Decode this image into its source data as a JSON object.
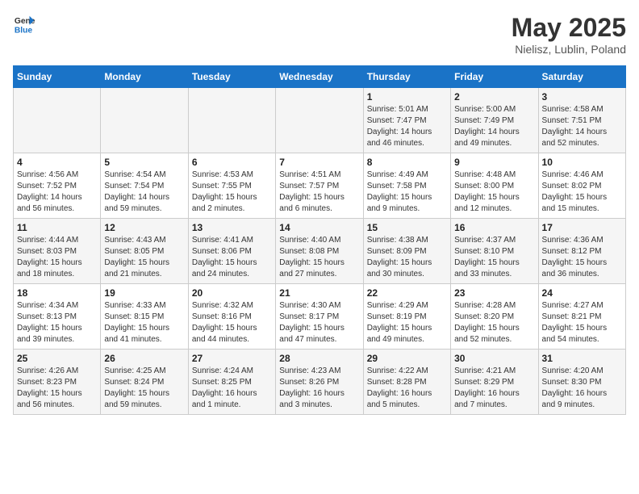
{
  "logo": {
    "line1": "General",
    "line2": "Blue"
  },
  "title": "May 2025",
  "subtitle": "Nielisz, Lublin, Poland",
  "weekdays": [
    "Sunday",
    "Monday",
    "Tuesday",
    "Wednesday",
    "Thursday",
    "Friday",
    "Saturday"
  ],
  "weeks": [
    [
      {
        "day": "",
        "info": ""
      },
      {
        "day": "",
        "info": ""
      },
      {
        "day": "",
        "info": ""
      },
      {
        "day": "",
        "info": ""
      },
      {
        "day": "1",
        "info": "Sunrise: 5:01 AM\nSunset: 7:47 PM\nDaylight: 14 hours\nand 46 minutes."
      },
      {
        "day": "2",
        "info": "Sunrise: 5:00 AM\nSunset: 7:49 PM\nDaylight: 14 hours\nand 49 minutes."
      },
      {
        "day": "3",
        "info": "Sunrise: 4:58 AM\nSunset: 7:51 PM\nDaylight: 14 hours\nand 52 minutes."
      }
    ],
    [
      {
        "day": "4",
        "info": "Sunrise: 4:56 AM\nSunset: 7:52 PM\nDaylight: 14 hours\nand 56 minutes."
      },
      {
        "day": "5",
        "info": "Sunrise: 4:54 AM\nSunset: 7:54 PM\nDaylight: 14 hours\nand 59 minutes."
      },
      {
        "day": "6",
        "info": "Sunrise: 4:53 AM\nSunset: 7:55 PM\nDaylight: 15 hours\nand 2 minutes."
      },
      {
        "day": "7",
        "info": "Sunrise: 4:51 AM\nSunset: 7:57 PM\nDaylight: 15 hours\nand 6 minutes."
      },
      {
        "day": "8",
        "info": "Sunrise: 4:49 AM\nSunset: 7:58 PM\nDaylight: 15 hours\nand 9 minutes."
      },
      {
        "day": "9",
        "info": "Sunrise: 4:48 AM\nSunset: 8:00 PM\nDaylight: 15 hours\nand 12 minutes."
      },
      {
        "day": "10",
        "info": "Sunrise: 4:46 AM\nSunset: 8:02 PM\nDaylight: 15 hours\nand 15 minutes."
      }
    ],
    [
      {
        "day": "11",
        "info": "Sunrise: 4:44 AM\nSunset: 8:03 PM\nDaylight: 15 hours\nand 18 minutes."
      },
      {
        "day": "12",
        "info": "Sunrise: 4:43 AM\nSunset: 8:05 PM\nDaylight: 15 hours\nand 21 minutes."
      },
      {
        "day": "13",
        "info": "Sunrise: 4:41 AM\nSunset: 8:06 PM\nDaylight: 15 hours\nand 24 minutes."
      },
      {
        "day": "14",
        "info": "Sunrise: 4:40 AM\nSunset: 8:08 PM\nDaylight: 15 hours\nand 27 minutes."
      },
      {
        "day": "15",
        "info": "Sunrise: 4:38 AM\nSunset: 8:09 PM\nDaylight: 15 hours\nand 30 minutes."
      },
      {
        "day": "16",
        "info": "Sunrise: 4:37 AM\nSunset: 8:10 PM\nDaylight: 15 hours\nand 33 minutes."
      },
      {
        "day": "17",
        "info": "Sunrise: 4:36 AM\nSunset: 8:12 PM\nDaylight: 15 hours\nand 36 minutes."
      }
    ],
    [
      {
        "day": "18",
        "info": "Sunrise: 4:34 AM\nSunset: 8:13 PM\nDaylight: 15 hours\nand 39 minutes."
      },
      {
        "day": "19",
        "info": "Sunrise: 4:33 AM\nSunset: 8:15 PM\nDaylight: 15 hours\nand 41 minutes."
      },
      {
        "day": "20",
        "info": "Sunrise: 4:32 AM\nSunset: 8:16 PM\nDaylight: 15 hours\nand 44 minutes."
      },
      {
        "day": "21",
        "info": "Sunrise: 4:30 AM\nSunset: 8:17 PM\nDaylight: 15 hours\nand 47 minutes."
      },
      {
        "day": "22",
        "info": "Sunrise: 4:29 AM\nSunset: 8:19 PM\nDaylight: 15 hours\nand 49 minutes."
      },
      {
        "day": "23",
        "info": "Sunrise: 4:28 AM\nSunset: 8:20 PM\nDaylight: 15 hours\nand 52 minutes."
      },
      {
        "day": "24",
        "info": "Sunrise: 4:27 AM\nSunset: 8:21 PM\nDaylight: 15 hours\nand 54 minutes."
      }
    ],
    [
      {
        "day": "25",
        "info": "Sunrise: 4:26 AM\nSunset: 8:23 PM\nDaylight: 15 hours\nand 56 minutes."
      },
      {
        "day": "26",
        "info": "Sunrise: 4:25 AM\nSunset: 8:24 PM\nDaylight: 15 hours\nand 59 minutes."
      },
      {
        "day": "27",
        "info": "Sunrise: 4:24 AM\nSunset: 8:25 PM\nDaylight: 16 hours\nand 1 minute."
      },
      {
        "day": "28",
        "info": "Sunrise: 4:23 AM\nSunset: 8:26 PM\nDaylight: 16 hours\nand 3 minutes."
      },
      {
        "day": "29",
        "info": "Sunrise: 4:22 AM\nSunset: 8:28 PM\nDaylight: 16 hours\nand 5 minutes."
      },
      {
        "day": "30",
        "info": "Sunrise: 4:21 AM\nSunset: 8:29 PM\nDaylight: 16 hours\nand 7 minutes."
      },
      {
        "day": "31",
        "info": "Sunrise: 4:20 AM\nSunset: 8:30 PM\nDaylight: 16 hours\nand 9 minutes."
      }
    ]
  ]
}
